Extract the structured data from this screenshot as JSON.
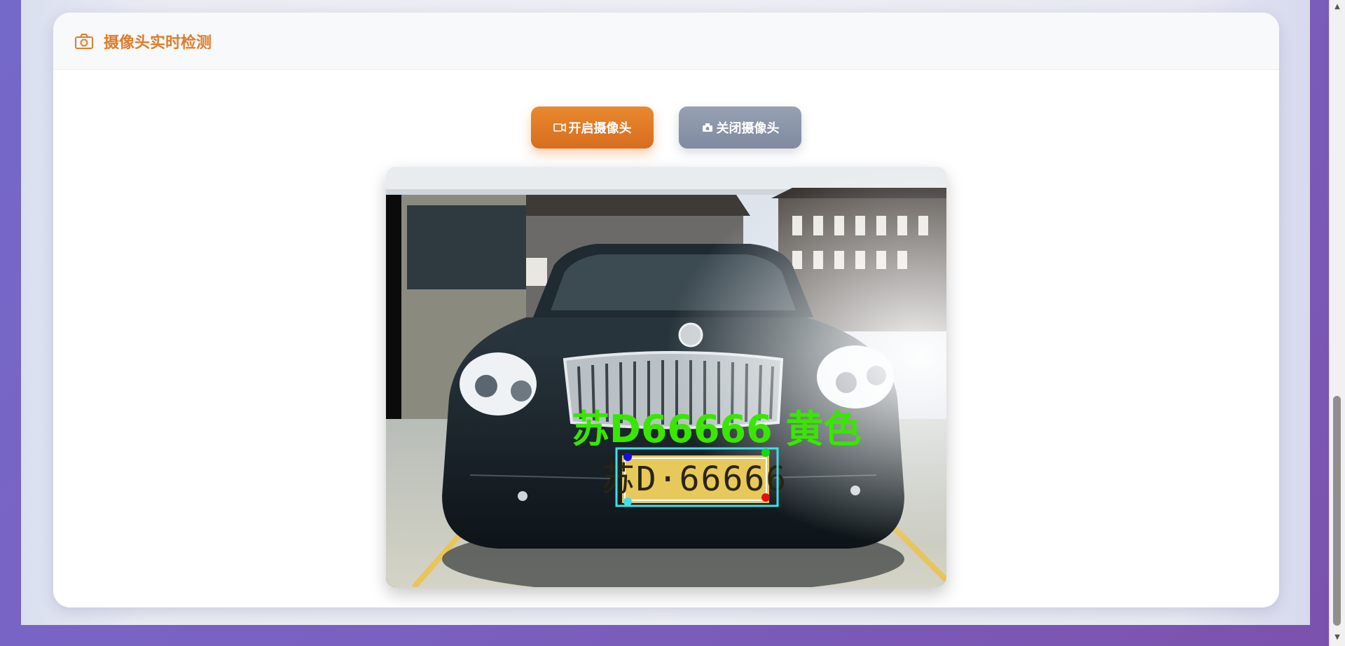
{
  "header": {
    "title": "摄像头实时检测",
    "icon": "camera-icon"
  },
  "controls": {
    "open_label": "开启摄像头",
    "open_icon": "video-camera-icon",
    "close_label": "关闭摄像头",
    "close_icon": "camera-off-icon"
  },
  "detection": {
    "overlay_text": "苏D66666 黄色",
    "plate_text": "苏D·66666",
    "overlay_color": "#39e600",
    "box_color": "#3fe0e8"
  },
  "colors": {
    "accent": "#e07c2a",
    "secondary_button": "#8a94a8"
  }
}
